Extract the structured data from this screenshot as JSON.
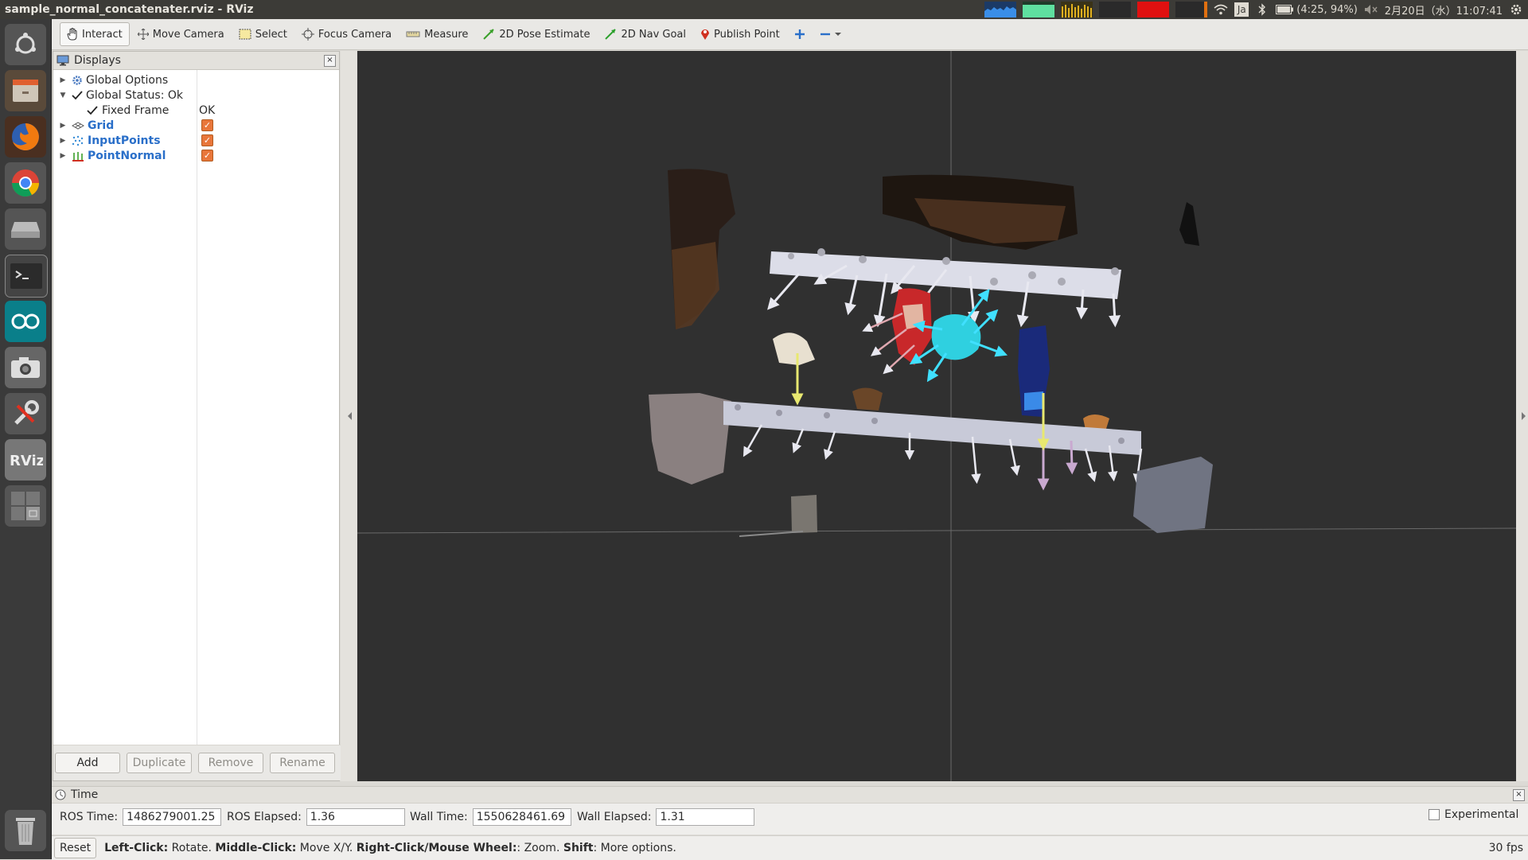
{
  "window": {
    "title": "sample_normal_concatenater.rviz - RViz"
  },
  "tray": {
    "keyboard": "Ja",
    "battery": "(4:25, 94%)",
    "datetime": "2月20日（水）11:07:41"
  },
  "toolbar": {
    "tools": [
      {
        "label": "Interact",
        "icon": "hand-icon"
      },
      {
        "label": "Move Camera",
        "icon": "move-camera-icon"
      },
      {
        "label": "Select",
        "icon": "select-icon"
      },
      {
        "label": "Focus Camera",
        "icon": "focus-camera-icon"
      },
      {
        "label": "Measure",
        "icon": "measure-icon"
      },
      {
        "label": "2D Pose Estimate",
        "icon": "pose-estimate-icon"
      },
      {
        "label": "2D Nav Goal",
        "icon": "nav-goal-icon"
      },
      {
        "label": "Publish Point",
        "icon": "publish-point-icon"
      }
    ]
  },
  "displays": {
    "title": "Displays",
    "items": [
      {
        "label": "Global Options"
      },
      {
        "label": "Global Status: Ok"
      },
      {
        "label": "Fixed Frame",
        "value": "OK"
      },
      {
        "label": "Grid",
        "checked": true
      },
      {
        "label": "InputPoints",
        "checked": true
      },
      {
        "label": "PointNormal",
        "checked": true
      }
    ],
    "buttons": {
      "add": "Add",
      "duplicate": "Duplicate",
      "remove": "Remove",
      "rename": "Rename"
    }
  },
  "time": {
    "title": "Time",
    "ros_time_label": "ROS Time:",
    "ros_time": "1486279001.25",
    "ros_elapsed_label": "ROS Elapsed:",
    "ros_elapsed": "1.36",
    "wall_time_label": "Wall Time:",
    "wall_time": "1550628461.69",
    "wall_elapsed_label": "Wall Elapsed:",
    "wall_elapsed": "1.31",
    "experimental_label": "Experimental"
  },
  "status": {
    "reset": "Reset",
    "help": [
      {
        "key": "Left-Click:",
        "text": " Rotate. "
      },
      {
        "key": "Middle-Click:",
        "text": " Move X/Y. "
      },
      {
        "key": "Right-Click/Mouse Wheel:",
        "text": ": Zoom. "
      },
      {
        "key": "Shift",
        "text": ": More options."
      }
    ],
    "fps": "30 fps"
  },
  "colors": {
    "viewport_bg": "#303030",
    "display_link": "#2a6fc9",
    "checkbox": "#e8763a",
    "cyan_object": "#2fd0e0"
  }
}
